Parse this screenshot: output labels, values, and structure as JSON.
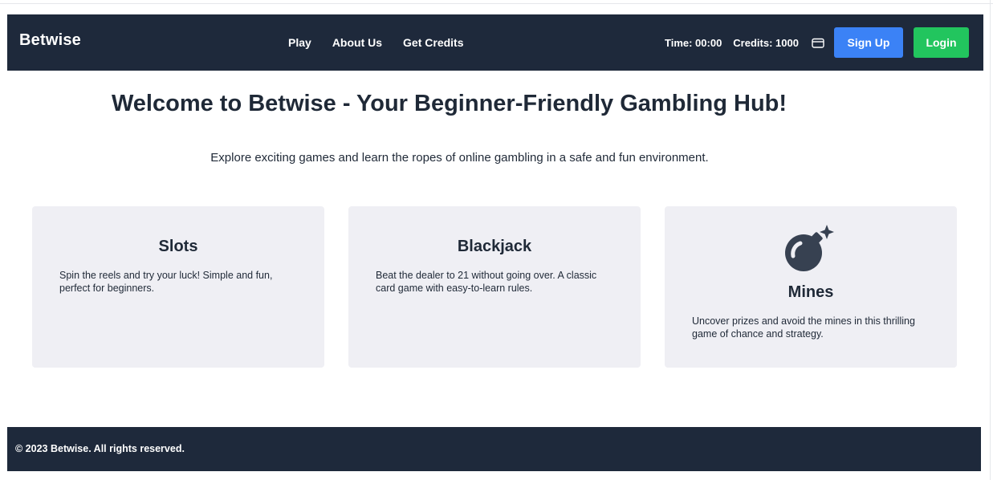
{
  "header": {
    "brand": "Betwise",
    "nav": {
      "play": "Play",
      "about": "About Us",
      "credits": "Get Credits"
    },
    "status": {
      "time": "Time: 00:00",
      "credits": "Credits: 1000",
      "wallet_icon": "wallet-icon"
    },
    "signup_label": "Sign Up",
    "login_label": "Login"
  },
  "hero": {
    "title": "Welcome to Betwise - Your Beginner-Friendly Gambling Hub!",
    "subtitle": "Explore exciting games and learn the ropes of online gambling in a safe and fun environment."
  },
  "games": [
    {
      "title": "Slots",
      "description": "Spin the reels and try your luck! Simple and fun, perfect for beginners."
    },
    {
      "title": "Blackjack",
      "description": "Beat the dealer to 21 without going over. A classic card game with easy-to-learn rules."
    },
    {
      "title": "Mines",
      "icon": "bomb-icon",
      "description": "Uncover prizes and avoid the mines in this thrilling game of chance and strategy."
    }
  ],
  "footer": {
    "text": "© 2023 Betwise. All rights reserved."
  },
  "colors": {
    "header_bg": "#1e293b",
    "signup_bg": "#3b82f6",
    "login_bg": "#22c55e",
    "card_bg": "#efeff4",
    "text_dark": "#1f2937"
  }
}
